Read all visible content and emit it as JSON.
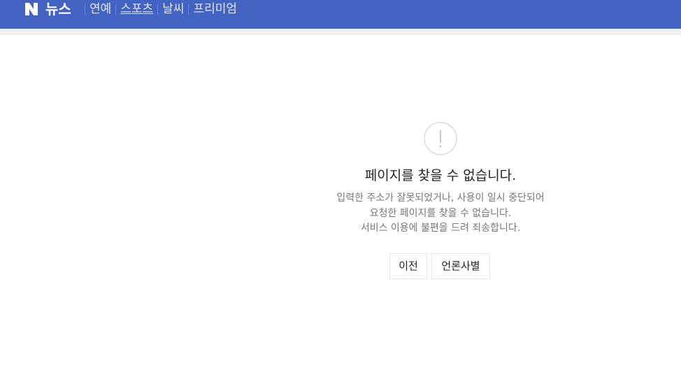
{
  "header": {
    "logo_letter": "N",
    "brand": "뉴스",
    "nav": [
      {
        "label": "연예"
      },
      {
        "label": "스포츠"
      },
      {
        "label": "날씨"
      },
      {
        "label": "프리미엄"
      }
    ],
    "bg_color": "#4263c1"
  },
  "error": {
    "icon": "alert-circle-icon",
    "title": "페이지를 찾을 수 없습니다.",
    "desc_lines": [
      "입력한 주소가 잘못되었거나, 사용이 일시 중단되어",
      "요청한 페이지를 찾을 수 없습니다.",
      "서비스 이용에 불편을 드려 죄송합니다."
    ]
  },
  "buttons": {
    "prev": "이전",
    "report": "언론사별"
  }
}
